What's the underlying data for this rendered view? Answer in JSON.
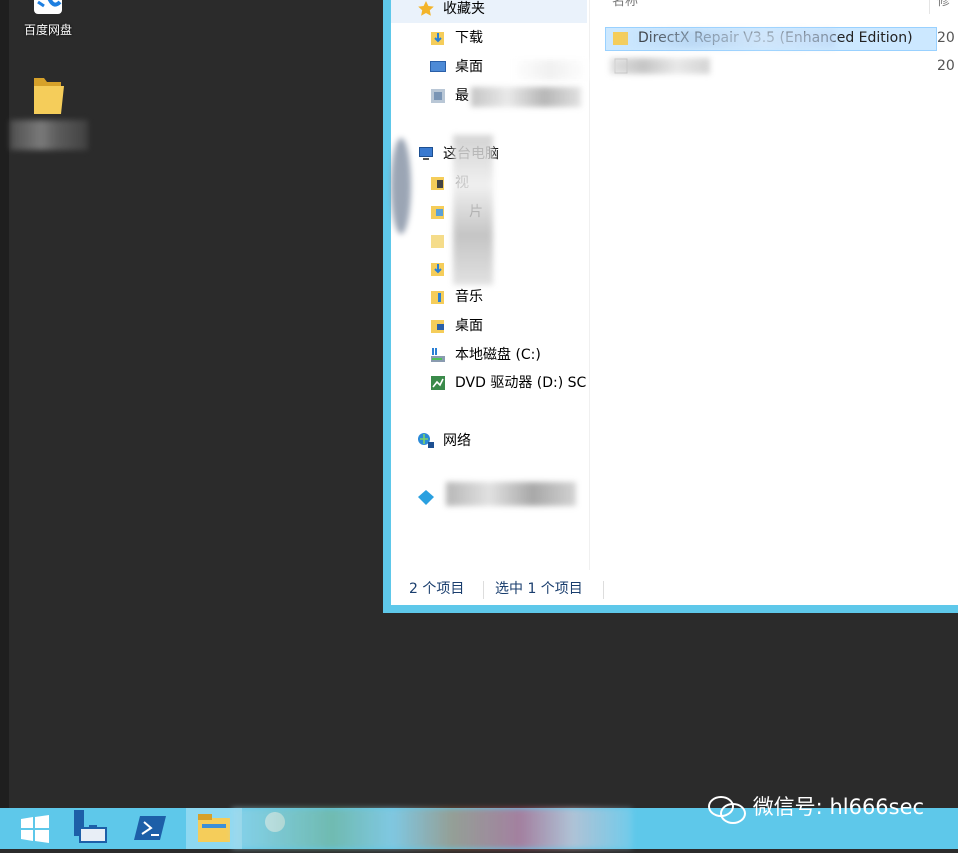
{
  "desktop": {
    "icons": [
      {
        "label": "百度网盘",
        "icon": "baidu-netdisk-icon"
      },
      {
        "label": "",
        "icon": "folder-icon"
      }
    ]
  },
  "explorer": {
    "nav": {
      "favorites": "收藏夹",
      "downloads": "下载",
      "desktop": "桌面",
      "recent": "最",
      "this_pc": "这台电脑",
      "videos": "视",
      "pictures": "片",
      "documents": "",
      "downloads2": "",
      "music": "音乐",
      "desktop2": "桌面",
      "local_disk": "本地磁盘 (C:)",
      "dvd_drive": "DVD 驱动器 (D:) SC",
      "network": "网络",
      "homegroup": ""
    },
    "columns": {
      "name": "名称",
      "modified": "修"
    },
    "files": [
      {
        "name": "DirectX Repair V3.5 (Enhanced Edition)",
        "date": "20",
        "selected": true
      },
      {
        "name": "",
        "date": "20",
        "selected": false
      }
    ],
    "status": {
      "item_count": "2 个项目",
      "selected": "选中 1 个项目"
    }
  },
  "taskbar": {
    "items": [
      "start-icon",
      "server-manager-icon",
      "powershell-icon",
      "file-explorer-icon",
      "app-icon"
    ]
  },
  "watermark": "微信号: hl666sec",
  "colors": {
    "accent": "#5ec8ea",
    "desktop": "#2b2b2b",
    "selection": "#cce8ff"
  }
}
